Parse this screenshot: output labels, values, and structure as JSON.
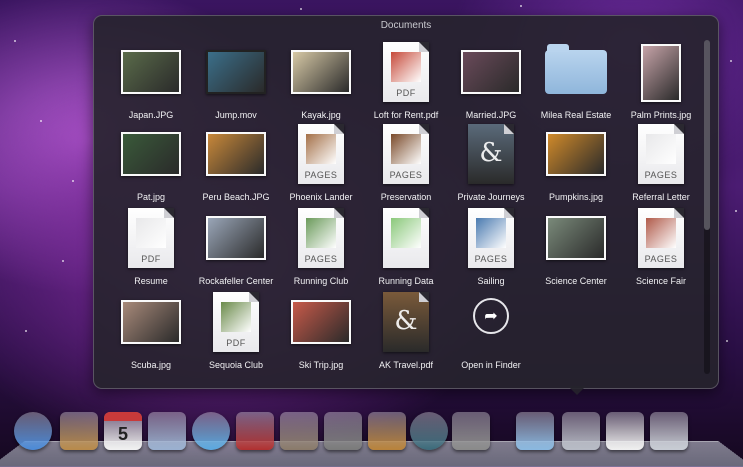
{
  "window": {
    "title": "Documents"
  },
  "items": [
    {
      "label": "Japan.JPG",
      "kind": "photo",
      "color": "#5a6b4a"
    },
    {
      "label": "Jump.mov",
      "kind": "video",
      "color": "#3b6f8a"
    },
    {
      "label": "Kayak.jpg",
      "kind": "photo",
      "color": "#d7c9a6"
    },
    {
      "label": "Loft for Rent.pdf",
      "kind": "pdf",
      "tag": "PDF",
      "color": "#c64a3a"
    },
    {
      "label": "Married.JPG",
      "kind": "photo",
      "color": "#6a4a5a"
    },
    {
      "label": "Milea Real Estate",
      "kind": "folder",
      "color": "#8fb6db"
    },
    {
      "label": "Palm Prints.jpg",
      "kind": "photo",
      "color": "#c6a3a8"
    },
    {
      "label": "Pat.jpg",
      "kind": "photo",
      "color": "#3a5a3a"
    },
    {
      "label": "Peru Beach.JPG",
      "kind": "photo",
      "color": "#c8883a"
    },
    {
      "label": "Phoenix Lander",
      "kind": "pages",
      "tag": "PAGES",
      "color": "#a47048"
    },
    {
      "label": "Preservation",
      "kind": "pages",
      "tag": "PAGES",
      "color": "#7a4a2a"
    },
    {
      "label": "Private Journeys",
      "kind": "keynote",
      "color": "#5a6a7a"
    },
    {
      "label": "Pumpkins.jpg",
      "kind": "photo",
      "color": "#d08a2a"
    },
    {
      "label": "Referral Letter",
      "kind": "pages",
      "tag": "PAGES",
      "color": "#e8e8ea"
    },
    {
      "label": "Resume",
      "kind": "pdf",
      "tag": "PDF",
      "color": "#e8e8ea"
    },
    {
      "label": "Rockafeller Center",
      "kind": "photo",
      "color": "#9aa6b8"
    },
    {
      "label": "Running Club",
      "kind": "pages",
      "tag": "PAGES",
      "color": "#6a9a5a"
    },
    {
      "label": "Running Data",
      "kind": "numbers",
      "color": "#8ac87a"
    },
    {
      "label": "Sailing",
      "kind": "pages",
      "tag": "PAGES",
      "color": "#4a7ab0"
    },
    {
      "label": "Science Center",
      "kind": "photo",
      "color": "#7a8a7a"
    },
    {
      "label": "Science Fair",
      "kind": "pages",
      "tag": "PAGES",
      "color": "#b05a4a"
    },
    {
      "label": "Scuba.jpg",
      "kind": "photo",
      "color": "#a88a7a"
    },
    {
      "label": "Sequoia Club",
      "kind": "pdf",
      "tag": "PDF",
      "color": "#6a8a4a"
    },
    {
      "label": "Ski Trip.jpg",
      "kind": "photo",
      "color": "#c85a4a"
    },
    {
      "label": "AK Travel.pdf",
      "kind": "keynote",
      "color": "#7a5a3a"
    },
    {
      "label": "Open in Finder",
      "kind": "finder",
      "color": "#ffffff"
    }
  ],
  "dock": [
    {
      "name": "facetime-icon",
      "color": "#4a8ad8"
    },
    {
      "name": "address-book-icon",
      "color": "#b88a4a"
    },
    {
      "name": "ical-icon",
      "color": "#f2f2f2"
    },
    {
      "name": "preview-icon",
      "color": "#9ab0d0"
    },
    {
      "name": "itunes-icon",
      "color": "#5aa8e0"
    },
    {
      "name": "photo-booth-icon",
      "color": "#b03030"
    },
    {
      "name": "iphoto-icon",
      "color": "#8a7a6a"
    },
    {
      "name": "imovie-icon",
      "color": "#7a7a7a"
    },
    {
      "name": "garageband-icon",
      "color": "#b8823a"
    },
    {
      "name": "time-machine-icon",
      "color": "#3a6a7a"
    },
    {
      "name": "system-preferences-icon",
      "color": "#8a8a8a"
    },
    {
      "name": "applications-folder-icon",
      "color": "#8ab8e0"
    },
    {
      "name": "documents-stack-icon",
      "color": "#b8bcc6"
    },
    {
      "name": "pdf-document-icon",
      "color": "#f0f0f0"
    },
    {
      "name": "trash-icon",
      "color": "#c8ccd4"
    }
  ]
}
